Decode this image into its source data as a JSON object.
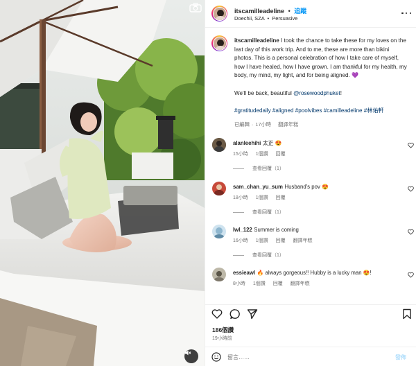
{
  "post": {
    "username": "itscamilleadeline",
    "follow_label": "追蹤",
    "location": "Doechii, SZA",
    "music": "Persuasive",
    "location_separator": "•"
  },
  "caption": {
    "username": "itscamilleadeline",
    "text": "I took the chance to take these for my loves on the last day of this work trip. And to me, these are more than bikini photos. This is a personal celebration of how I take care of myself, how I have healed, how I have grown. I am thankful for my health, my body, my mind, my light, and for being aligned.",
    "heart": "💜",
    "line2_prefix": "We'll be back, beautiful ",
    "mention": "@rosewoodphuket",
    "line2_suffix": "!",
    "hashtags": "#gratitudedaily #aligned #poolvibes #camilleadeline #林佑軒",
    "edited_label": "已編輯",
    "time": "17小時",
    "translate_label": "翻譯年糕"
  },
  "comments": [
    {
      "username": "alanleehihi",
      "text": "太正 😍",
      "time": "15小時",
      "likes": "1個讚",
      "reply_label": "回覆",
      "translate": "",
      "view_replies": "查看回覆（1）"
    },
    {
      "username": "sam_chan_yu_sum",
      "text": "Husband's pov 😍",
      "time": "18小時",
      "likes": "1個讚",
      "reply_label": "回覆",
      "translate": "",
      "view_replies": "查看回覆（1）"
    },
    {
      "username": "lwl_122",
      "text": "Summer is coming",
      "time": "16小時",
      "likes": "1個讚",
      "reply_label": "回覆",
      "translate": "翻譯年糕",
      "view_replies": "查看回覆（1）"
    },
    {
      "username": "essieawl",
      "text": "🔥 always gorgeous!! Hubby is a lucky man 😍!",
      "time": "8小時",
      "likes": "1個讚",
      "reply_label": "回覆",
      "translate": "翻譯年糕",
      "view_replies": ""
    }
  ],
  "actions": {
    "likes_count": "186個讚",
    "time_ago": "19小時前",
    "comment_placeholder": "留言……"
  },
  "icons": {
    "camera": "camera-icon",
    "mute": "sound-off-icon",
    "like": "heart-icon",
    "comment": "comment-icon",
    "share": "send-icon",
    "save": "bookmark-icon",
    "emoji": "smiley-icon",
    "more": "more-icon"
  },
  "colors": {
    "accent": "#0095f6",
    "link": "#00376b",
    "muted": "#737373"
  }
}
